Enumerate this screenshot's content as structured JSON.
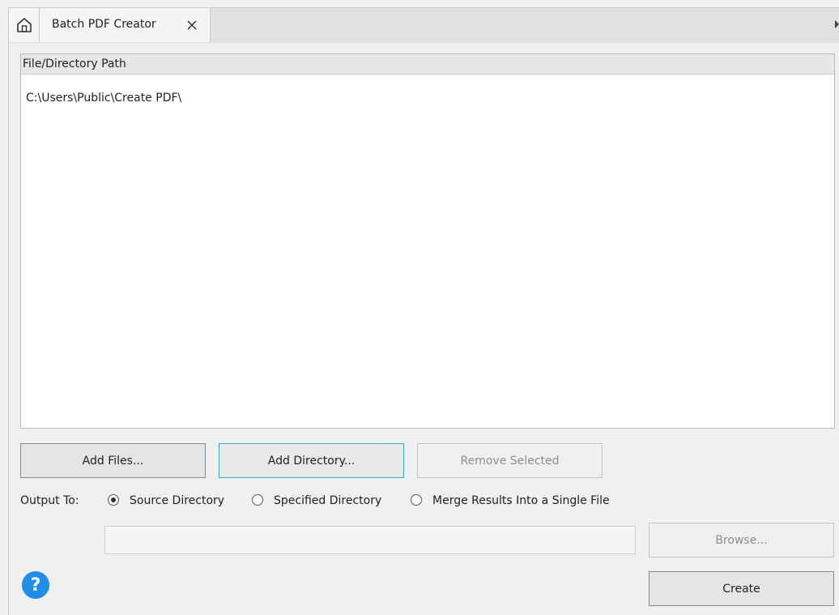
{
  "tabs": {
    "home_icon": "home-icon",
    "active_tab_label": "Batch PDF Creator",
    "close_icon": "close-icon"
  },
  "file_list": {
    "column_header": "File/Directory Path",
    "rows": [
      "C:\\Users\\Public\\Create PDF\\"
    ]
  },
  "buttons": {
    "add_files": "Add Files...",
    "add_directory": "Add Directory...",
    "remove_selected": "Remove Selected",
    "browse": "Browse...",
    "create": "Create"
  },
  "output": {
    "label": "Output To:",
    "options": [
      {
        "label": "Source Directory",
        "checked": true
      },
      {
        "label": "Specified Directory",
        "checked": false
      },
      {
        "label": "Merge Results Into a Single File",
        "checked": false
      }
    ],
    "directory_value": ""
  },
  "help": {
    "icon": "help-icon",
    "glyph": "?"
  },
  "colors": {
    "focus_accent": "#37b0ae",
    "help_blue": "#1e8ee8"
  }
}
